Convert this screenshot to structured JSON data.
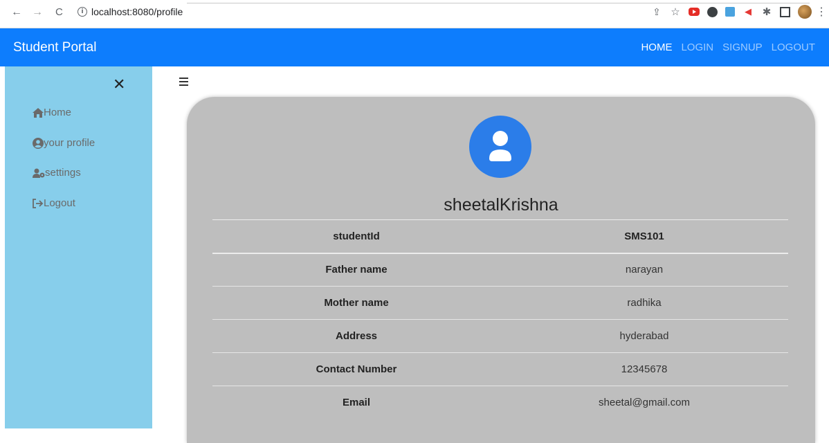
{
  "browser": {
    "url": "localhost:8080/profile"
  },
  "navbar": {
    "brand": "Student Portal",
    "links": [
      {
        "label": "HOME",
        "active": true
      },
      {
        "label": "LOGIN",
        "active": false
      },
      {
        "label": "SIGNUP",
        "active": false
      },
      {
        "label": "LOGOUT",
        "active": false
      }
    ]
  },
  "sidebar": {
    "close_symbol": "✕",
    "items": [
      {
        "label": "Home",
        "icon": "home-icon"
      },
      {
        "label": "your profile",
        "icon": "user-circle-icon"
      },
      {
        "label": "settings",
        "icon": "user-cog-icon"
      },
      {
        "label": "Logout",
        "icon": "sign-out-icon"
      }
    ]
  },
  "profile": {
    "name": "sheetalKrishna",
    "rows": [
      {
        "field": "studentId",
        "value": "SMS101"
      },
      {
        "field": "Father name",
        "value": "narayan"
      },
      {
        "field": "Mother name",
        "value": "radhika"
      },
      {
        "field": "Address",
        "value": "hyderabad"
      },
      {
        "field": "Contact Number",
        "value": "12345678"
      },
      {
        "field": "Email",
        "value": "sheetal@gmail.com"
      }
    ]
  },
  "colors": {
    "navbar": "#0d7dfd",
    "sidebar": "#87ceeb",
    "card": "#bebebe",
    "avatar": "#2b7de9"
  }
}
